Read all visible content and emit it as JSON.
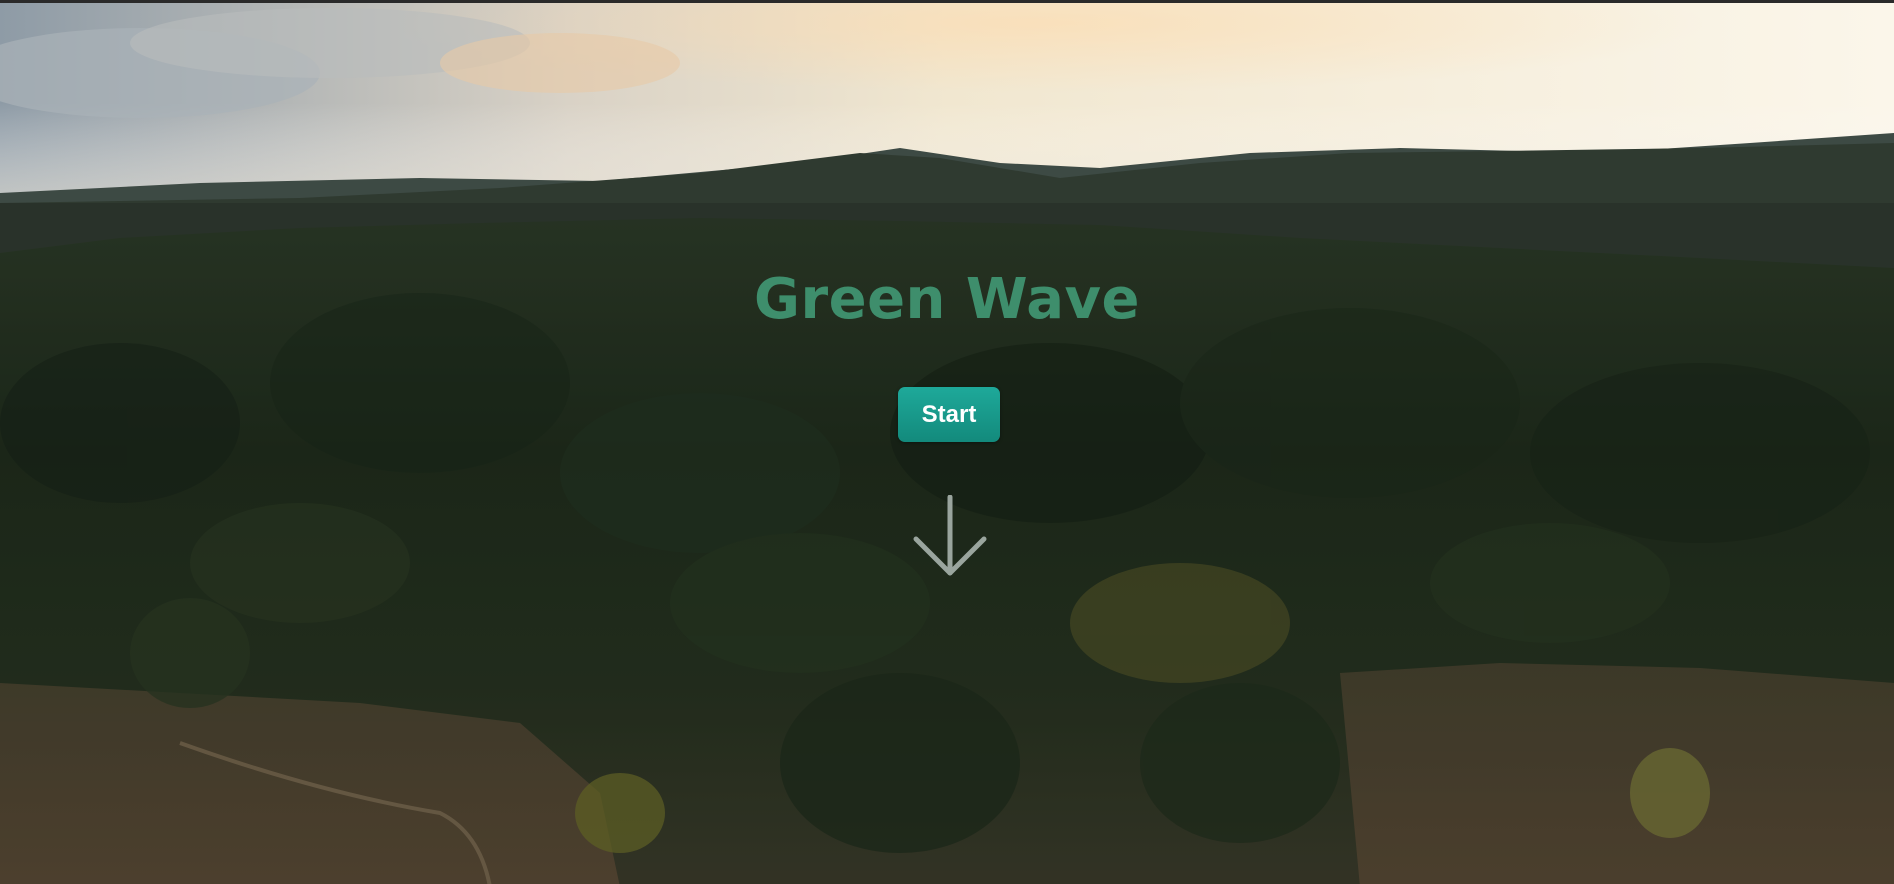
{
  "hero": {
    "title": "Green Wave",
    "start_label": "Start",
    "scroll_icon": "arrow-down-icon"
  },
  "colors": {
    "title": "#3e8e6c",
    "button": "#1ea99a",
    "button_text": "#ffffff",
    "arrow": "#9aa59e"
  }
}
